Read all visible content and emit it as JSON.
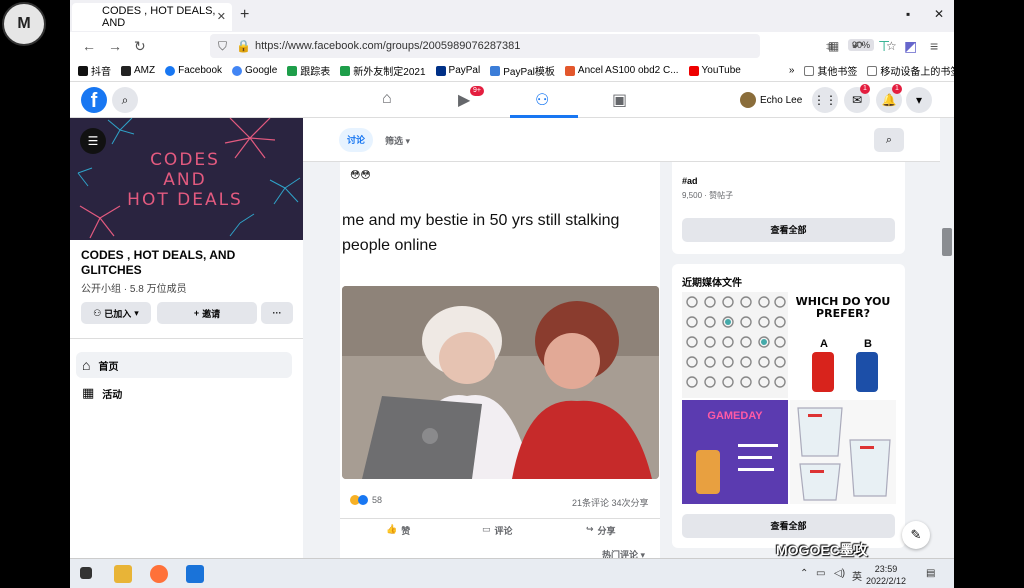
{
  "browser": {
    "tab_title": "CODES , HOT DEALS, AND",
    "url": "https://www.facebook.com/groups/2005989076287381",
    "zoom": "90%",
    "bookmarks": [
      "抖音",
      "AMZ",
      "Facebook",
      "Google",
      "跟踪表",
      "新外友制定2021",
      "PayPal",
      "PayPal模板",
      "Ancel AS100 obd2 C...",
      "YouTube"
    ],
    "bookmarks_right": [
      "其他书签",
      "移动设备上的书签"
    ]
  },
  "fb": {
    "watch_badge": "9+",
    "profile_name": "Echo Lee",
    "messenger_badge": "1",
    "notif_badge": "1"
  },
  "group": {
    "cover_line1": "CODES",
    "cover_line2": "AND",
    "cover_line3": "HOT DEALS",
    "name": "CODES , HOT DEALS, AND GLITCHES",
    "meta": "公开小组 · 5.8 万位成员",
    "joined_label": "已加入",
    "invite_label": "邀请",
    "more_label": "···",
    "menu": [
      {
        "label": "首页"
      },
      {
        "label": "活动"
      }
    ]
  },
  "feed": {
    "tab_discuss": "讨论",
    "filter_label": "筛选",
    "post": {
      "emoji_line": "😳😳",
      "text": "me and my bestie in 50 yrs still stalking people online",
      "reaction_count": "58",
      "comments": "21条评论",
      "shares": "34次分享",
      "like": "赞",
      "comment": "评论",
      "share": "分享",
      "sort": "热门评论"
    }
  },
  "right": {
    "ad_tag": "#ad",
    "ad_meta": "9,500 · 赞帖子",
    "see_all_1": "查看全部",
    "media_title": "近期媒体文件",
    "media_which": "WHICH DO YOU PREFER?",
    "media_a": "A",
    "media_b": "B",
    "media_gameday": "GAMEDAY",
    "see_all_2": "查看全部"
  },
  "taskbar": {
    "time": "23:59",
    "date": "2022/2/12",
    "ime": "英"
  },
  "watermark": "MOGOEC墨攻",
  "logo_text": "M"
}
